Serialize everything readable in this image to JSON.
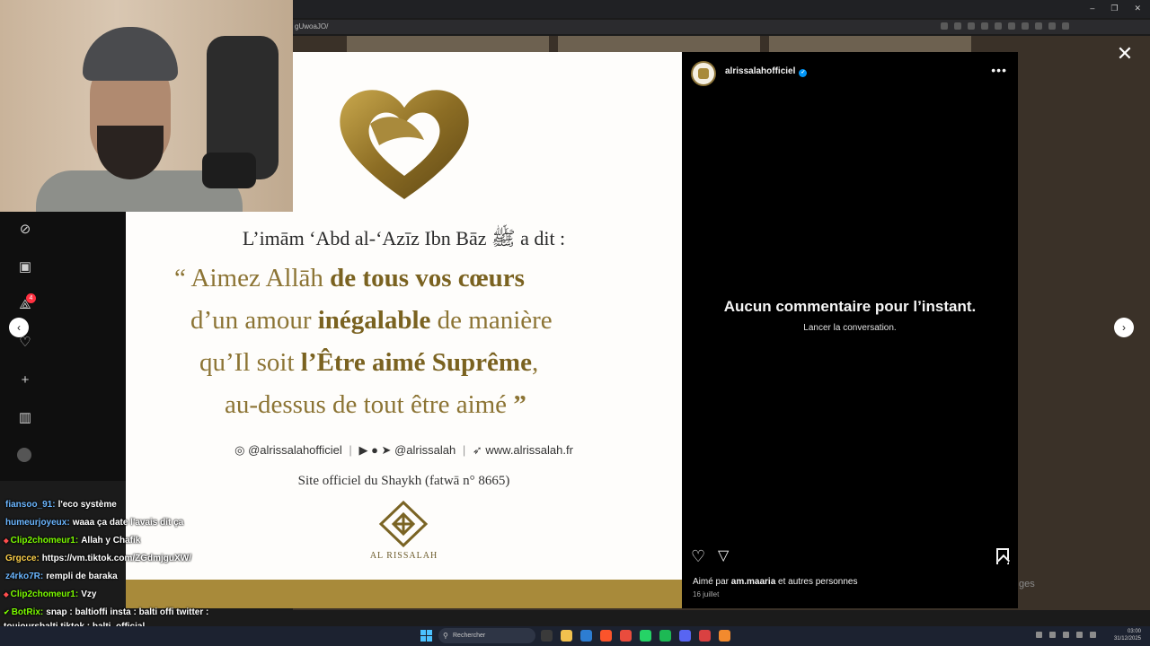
{
  "browser": {
    "address": "gUwoaJO/"
  },
  "post": {
    "intro": "L’imām ‘Abd al-‘Azīz Ibn Bāz ﷺ a dit :",
    "quote_lines": [
      {
        "pre": "“ Aimez Allāh ",
        "bold": "de tous vos cœurs",
        "post": ""
      },
      {
        "pre": "d’un amour ",
        "bold": "inégalable",
        "post": " de manière"
      },
      {
        "pre": "qu’Il soit ",
        "bold": "l’Être aimé Suprême",
        "post": ","
      },
      {
        "pre": "au-dessus de tout être aimé ",
        "bold": "",
        "post": "”"
      }
    ],
    "social_instagram": "@alrissalahofficiel",
    "social_youtube": "@alrissalah",
    "social_web": "www.alrissalah.fr",
    "site_official": "Site officiel du Shaykh (fatwā n° 8665)",
    "brand_name": "AL RISSALAH"
  },
  "panel": {
    "author": "alrissalahofficiel",
    "no_comments": "Aucun commentaire pour l’instant.",
    "start_conversation": "Lancer la conversation.",
    "liked_by_prefix": "Aimé par ",
    "liked_by_user": "am.maaria",
    "liked_by_suffix": " et autres personnes",
    "date": "16 juillet"
  },
  "chat": [
    {
      "badge": "",
      "user": "fiansoo_91:",
      "user_color": "#6bb6ff",
      "message": "l'eco système"
    },
    {
      "badge": "",
      "user": "humeurjoyeux:",
      "user_color": "#6bb6ff",
      "message": "waaa ça date l'avais dit ça"
    },
    {
      "badge": "⬥",
      "user": "Clip2chomeur1:",
      "user_color": "#7cfc00",
      "message": "Allah y Chafik"
    },
    {
      "badge": "",
      "user": "Grgcce:",
      "user_color": "#ffd24a",
      "message": "https://vm.tiktok.com/ZGdmjguXW/"
    },
    {
      "badge": "",
      "user": "z4rko7R:",
      "user_color": "#6bb6ff",
      "message": "rempli de baraka"
    },
    {
      "badge": "⬥",
      "user": "Clip2chomeur1:",
      "user_color": "#7cfc00",
      "message": "Vzy"
    },
    {
      "badge": "✔",
      "user": "BotRix:",
      "user_color": "#7cfc00",
      "message": "snap : baltioffi insta : balti offi twitter :"
    },
    {
      "badge": "",
      "user": "",
      "user_color": "#ffffff",
      "message": "toujoursbalti tiktok : balti_official"
    }
  ],
  "taskbar": {
    "search_placeholder": "Rechercher",
    "time": "03:00",
    "date": "31/12/2025"
  },
  "ghost": "ges",
  "colors": {
    "gold": "#a88a3a",
    "panel_bg": "#000000",
    "verified": "#0095f6"
  }
}
